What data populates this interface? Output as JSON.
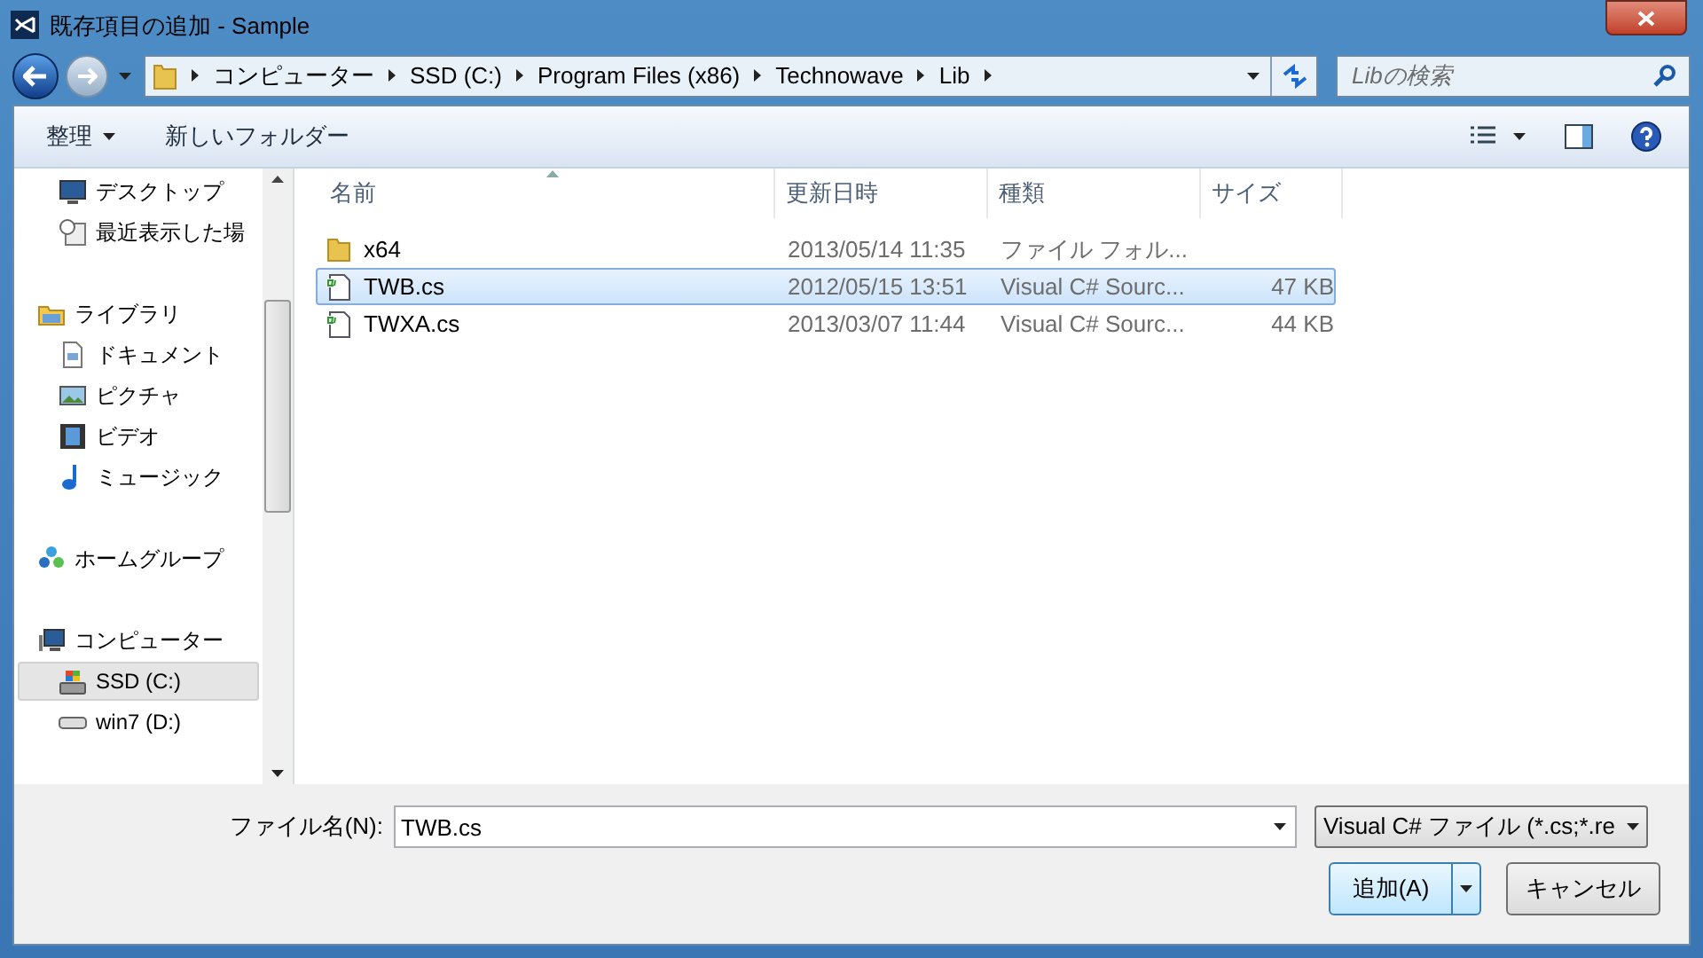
{
  "window": {
    "title": "既存項目の追加 - Sample"
  },
  "address_bar": {
    "breadcrumbs": [
      "コンピューター",
      "SSD (C:)",
      "Program Files (x86)",
      "Technowave",
      "Lib"
    ]
  },
  "search": {
    "placeholder": "Libの検索"
  },
  "toolbar": {
    "organize": "整理",
    "new_folder": "新しいフォルダー"
  },
  "nav_groups": [
    {
      "children": [
        {
          "label": "デスクトップ",
          "kind": "desktop",
          "selected": false
        },
        {
          "label": "最近表示した場",
          "kind": "recent",
          "selected": false
        }
      ]
    },
    {
      "label": "ライブラリ",
      "kind": "library",
      "selected": false,
      "children": [
        {
          "label": "ドキュメント",
          "kind": "document",
          "selected": false
        },
        {
          "label": "ピクチャ",
          "kind": "picture",
          "selected": false
        },
        {
          "label": "ビデオ",
          "kind": "video",
          "selected": false
        },
        {
          "label": "ミュージック",
          "kind": "music",
          "selected": false
        }
      ]
    },
    {
      "label": "ホームグループ",
      "kind": "homegroup",
      "selected": false
    },
    {
      "label": "コンピューター",
      "kind": "computer",
      "selected": false,
      "children": [
        {
          "label": "SSD (C:)",
          "kind": "system_drive",
          "selected": true
        },
        {
          "label": "win7 (D:)",
          "kind": "drive",
          "selected": false
        }
      ]
    }
  ],
  "table": {
    "columns": [
      {
        "label": "名前",
        "sorted": true
      },
      {
        "label": "更新日時",
        "sorted": false
      },
      {
        "label": "種類",
        "sorted": false
      },
      {
        "label": "サイズ",
        "sorted": false
      }
    ],
    "rows": [
      {
        "kind": "folder",
        "name": "x64",
        "modified": "2013/05/14 11:35",
        "type": "ファイル フォル...",
        "selected": false
      },
      {
        "kind": "csharp",
        "name": "TWB.cs",
        "modified": "2012/05/15 13:51",
        "type": "Visual C# Sourc...",
        "size": "47 KB",
        "selected": true
      },
      {
        "kind": "csharp",
        "name": "TWXA.cs",
        "modified": "2013/03/07 11:44",
        "type": "Visual C# Sourc...",
        "size": "44 KB",
        "selected": false
      }
    ]
  },
  "file_name": {
    "label": "ファイル名(N):",
    "value": "TWB.cs"
  },
  "file_type": {
    "value": "Visual C# ファイル (*.cs;*.re"
  },
  "buttons": {
    "add": "追加(A)",
    "cancel": "キャンセル"
  }
}
